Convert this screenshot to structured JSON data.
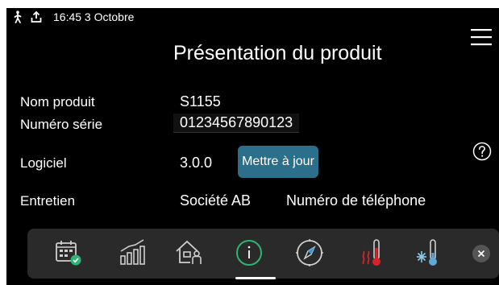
{
  "status_bar": {
    "time": "16:45 3 Octobre",
    "icons": [
      "walking-person-icon",
      "upload-icon"
    ]
  },
  "header": {
    "title": "Présentation du produit",
    "menu_icon": "hamburger-menu-icon"
  },
  "product": {
    "name_label": "Nom produit",
    "name_value": "S1155",
    "serial_label": "Numéro série",
    "serial_value": "01234567890123",
    "software_label": "Logiciel",
    "software_value": "3.0.0",
    "update_button": "Mettre à jour",
    "service_label": "Entretien",
    "service_company": "Société AB",
    "service_phone": "Numéro de téléphone"
  },
  "help_icon": "question-mark-icon",
  "nav": {
    "items": [
      {
        "icon": "calendar-check-icon"
      },
      {
        "icon": "bar-chart-icon"
      },
      {
        "icon": "house-person-icon"
      },
      {
        "icon": "info-icon",
        "active": true
      },
      {
        "icon": "compass-icon"
      },
      {
        "icon": "heating-thermometer-icon"
      },
      {
        "icon": "cooling-thermometer-icon"
      }
    ],
    "close_icon": "close-icon"
  },
  "colors": {
    "background": "#000000",
    "button": "#2b6f8a",
    "heat_accent": "#d8232a",
    "nav_background": "#2a2a2a"
  }
}
